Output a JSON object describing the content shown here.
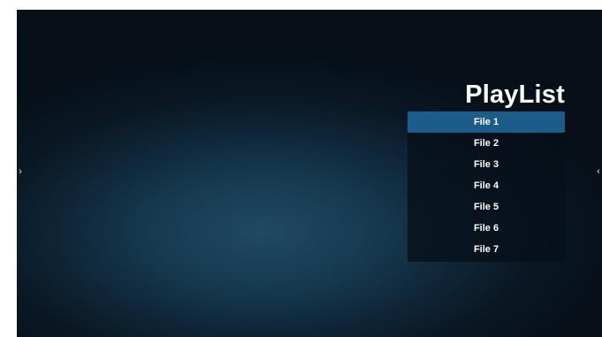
{
  "playlist": {
    "title": "PlayList",
    "items": [
      {
        "label": "File 1",
        "selected": true
      },
      {
        "label": "File 2",
        "selected": false
      },
      {
        "label": "File 3",
        "selected": false
      },
      {
        "label": "File 4",
        "selected": false
      },
      {
        "label": "File 5",
        "selected": false
      },
      {
        "label": "File 6",
        "selected": false
      },
      {
        "label": "File 7",
        "selected": false
      }
    ]
  },
  "nav": {
    "left_icon": "chevron-right-icon",
    "right_icon": "chevron-left-icon",
    "left_glyph": "›",
    "right_glyph": "‹"
  },
  "colors": {
    "selection": "#1b5c8a",
    "panel": "#061018",
    "text": "#ffffff"
  }
}
